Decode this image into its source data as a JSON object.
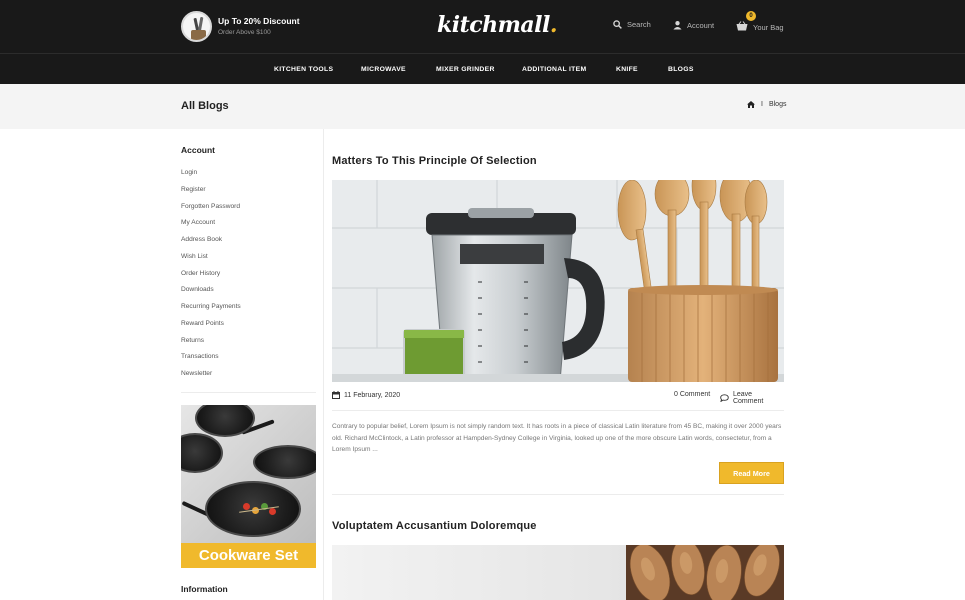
{
  "header": {
    "promo": {
      "title": "Up To 20% Discount",
      "subtitle": "Order Above $100"
    },
    "logo": {
      "name": "kitchmall",
      "dot": "."
    },
    "search_label": "Search",
    "account_label": "Account",
    "bag_label": "Your Bag",
    "bag_count": "0"
  },
  "nav": {
    "items": [
      "KITCHEN TOOLS",
      "MICROWAVE",
      "MIXER GRINDER",
      "ADDITIONAL ITEM",
      "KNIFE",
      "BLOGS"
    ]
  },
  "breadcrumb": {
    "page_title": "All Blogs",
    "separator": "I",
    "current": "Blogs"
  },
  "sidebar": {
    "account_heading": "Account",
    "links": [
      "Login",
      "Register",
      "Forgotten Password",
      "My Account",
      "Address Book",
      "Wish List",
      "Order History",
      "Downloads",
      "Recurring Payments",
      "Reward Points",
      "Returns",
      "Transactions",
      "Newsletter"
    ],
    "banner_text": "Cookware Set",
    "information_heading": "Information"
  },
  "posts": [
    {
      "title": "Matters To This Principle Of Selection",
      "date": "11 February, 2020",
      "comment_count": "0 Comment",
      "leave_comment": "Leave Comment",
      "excerpt": "Contrary to popular belief, Lorem Ipsum is not simply random text. It has roots in a piece of classical Latin literature from 45 BC, making it over 2000 years old. Richard McClintock, a Latin professor at Hampden-Sydney College in Virginia, looked up one of the more obscure Latin words, consectetur, from a Lorem Ipsum ...",
      "read_more": "Read More"
    },
    {
      "title": "Voluptatem Accusantium Doloremque"
    }
  ],
  "colors": {
    "header_bg": "#191919",
    "accent": "#f0b92c",
    "band_bg": "#f4f4f4"
  },
  "icons": [
    "search-icon",
    "user-icon",
    "basket-icon",
    "home-icon",
    "calendar-icon",
    "comment-icon"
  ]
}
